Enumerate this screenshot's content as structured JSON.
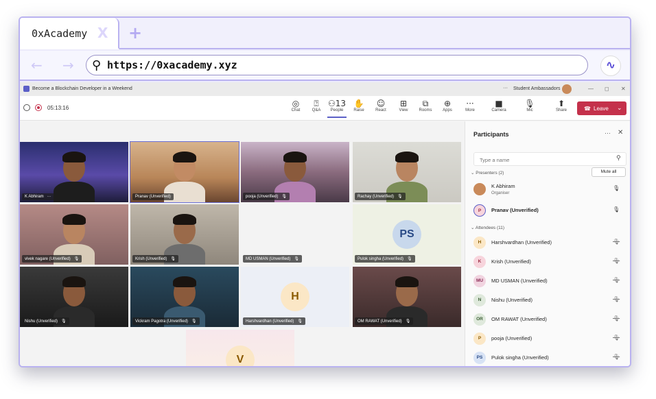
{
  "browser": {
    "tab_title": "0xAcademy",
    "tab_close": "X",
    "new_tab": "+",
    "back": "←",
    "forward": "→",
    "url": "https://0xacademy.xyz",
    "logo_icon": "wave-logo-icon"
  },
  "teams": {
    "window_title": "Become a Blockchain Developer in a Weekend",
    "more": "···",
    "org": "Student Ambassadors",
    "timer": "05:13:16",
    "toolbar": [
      {
        "label": "Chat",
        "glyph": "◎"
      },
      {
        "label": "Q&A",
        "glyph": "⍰"
      },
      {
        "label": "People",
        "glyph": "⚇13",
        "active": true
      },
      {
        "label": "Raise",
        "glyph": "✋"
      },
      {
        "label": "React",
        "glyph": "☺"
      },
      {
        "label": "View",
        "glyph": "⊞"
      },
      {
        "label": "Rooms",
        "glyph": "⧉"
      },
      {
        "label": "Apps",
        "glyph": "⊕"
      },
      {
        "label": "More",
        "glyph": "···"
      },
      {
        "label": "Camera",
        "glyph": "■"
      },
      {
        "label": "Mic",
        "glyph": "🎙"
      },
      {
        "label": "Share",
        "glyph": "⬆"
      }
    ],
    "leave_label": "Leave",
    "participants_title": "Participants",
    "search_placeholder": "Type a name",
    "presenters_header": "Presenters (2)",
    "mute_all": "Mute all",
    "attendees_header": "Attendees (11)",
    "presenters": [
      {
        "initials": "",
        "name": "K Abhiram",
        "sub": "Organiser",
        "mic": "🎙"
      },
      {
        "initials": "P",
        "name": "Pranav (Unverified)",
        "sub": "",
        "mic": "🎙",
        "bold": true
      }
    ],
    "attendees": [
      {
        "initials": "H",
        "name": "Harshvardhan (Unverified)",
        "mic": "🎙",
        "bg": "#fbe7c6",
        "fg": "#8a5a00"
      },
      {
        "initials": "K",
        "name": "Krish (Unverified)",
        "mic": "🎙",
        "bg": "#f7d4dc",
        "fg": "#9a2d45"
      },
      {
        "initials": "MU",
        "name": "MD USMAN (Unverified)",
        "mic": "🎙",
        "bg": "#f1d4e0",
        "fg": "#8a2c55"
      },
      {
        "initials": "N",
        "name": "Nishu (Unverified)",
        "mic": "🎙",
        "bg": "#dfe9dc",
        "fg": "#3b5e34"
      },
      {
        "initials": "OR",
        "name": "OM RAWAT (Unverified)",
        "mic": "🎙",
        "bg": "#dfe9dc",
        "fg": "#3b5e34"
      },
      {
        "initials": "P",
        "name": "pooja (Unverified)",
        "mic": "🎙",
        "bg": "#fbe7c6",
        "fg": "#8a5a00"
      },
      {
        "initials": "PS",
        "name": "Pulok singha (Unverified)",
        "mic": "🎙",
        "bg": "#d8e3f5",
        "fg": "#294a86"
      }
    ],
    "tiles": [
      {
        "name": "K Abhiram",
        "extra": "···",
        "bg": "linear-gradient(180deg,#2a2f6e 0%,#5a4aa8 55%,#1e1d3a 100%)",
        "skin": "#8a5a3c",
        "shirt": "#1d1d1d"
      },
      {
        "name": "Pranav (Unverified)",
        "bg": "linear-gradient(180deg,#d7b38c 0%,#b88558 60%,#6a4630 100%)",
        "skin": "#c28b64",
        "shirt": "#e9dfd2"
      },
      {
        "name": "pooja (Unverified)",
        "mic": "🎙",
        "bg": "linear-gradient(180deg,#c9b4c8 0%,#8a6b7e 50%,#4a3a48 100%)",
        "skin": "#8a5a3c",
        "shirt": "#b37fb0"
      },
      {
        "name": "Rachay (Unverified)",
        "mic": "🎙",
        "bg": "linear-gradient(180deg,#dcdcd6 0%,#cbc9c2 100%)",
        "skin": "#b98561",
        "shirt": "#7c8d57"
      },
      {
        "name": "vivek nagare (Unverified)",
        "mic": "🎙",
        "bg": "linear-gradient(180deg,#b58a86 0%,#806060 100%)",
        "skin": "#b98561",
        "shirt": "#d8cbb8"
      },
      {
        "name": "Krish (Unverified)",
        "mic": "🎙",
        "bg": "linear-gradient(180deg,#bfb7aa 0%,#8f877c 100%)",
        "skin": "#9a6a4a",
        "shirt": "#6d6d6d"
      },
      {
        "name": "MD USMAN (Unverified)",
        "mic": "🎙",
        "bg": "#f3f3f3",
        "skin": "",
        "shirt": ""
      },
      {
        "name": "Pulok singha (Unverified)",
        "mic": "🎙",
        "initials": "PS",
        "bg": "#eef1e4",
        "ibg": "#c8d8ec",
        "ifg": "#294a86"
      },
      {
        "name": "Nishu (Unverified)",
        "mic": "🎙",
        "bg": "linear-gradient(180deg,#3a3a3a 0%,#1a1a1a 100%)",
        "skin": "#8a5a3c",
        "shirt": "#2a2a2a"
      },
      {
        "name": "Vickram Pagotra (Unverified)",
        "mic": "🎙",
        "bg": "linear-gradient(180deg,#2a4a5e 0%,#1a2a36 100%)",
        "skin": "#8a5a3c",
        "shirt": "#3a5a70"
      },
      {
        "name": "Harshvardhan (Unverified)",
        "mic": "🎙",
        "initials": "H",
        "bg": "#eceff6",
        "ibg": "#fbe7c6",
        "ifg": "#8a5a00"
      },
      {
        "name": "OM RAWAT (Unverified)",
        "mic": "🎙",
        "bg": "linear-gradient(180deg,#6a4a4a 0%,#3a2a2a 100%)",
        "skin": "#9a6a4a",
        "shirt": "#2a2a2a"
      },
      {
        "name": "",
        "initials": "V",
        "bg": "linear-gradient(180deg,#f7e7ec 0%,#fbf1e4 100%)",
        "ibg": "#fbe7c6",
        "ifg": "#8a5a00"
      }
    ]
  }
}
